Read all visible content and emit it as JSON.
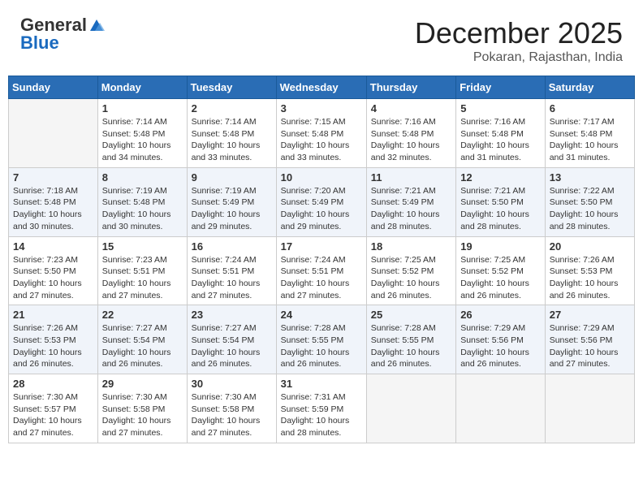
{
  "header": {
    "logo_general": "General",
    "logo_blue": "Blue",
    "title": "December 2025",
    "subtitle": "Pokaran, Rajasthan, India"
  },
  "weekdays": [
    "Sunday",
    "Monday",
    "Tuesday",
    "Wednesday",
    "Thursday",
    "Friday",
    "Saturday"
  ],
  "weeks": [
    [
      {
        "day": "",
        "info": ""
      },
      {
        "day": "1",
        "info": "Sunrise: 7:14 AM\nSunset: 5:48 PM\nDaylight: 10 hours\nand 34 minutes."
      },
      {
        "day": "2",
        "info": "Sunrise: 7:14 AM\nSunset: 5:48 PM\nDaylight: 10 hours\nand 33 minutes."
      },
      {
        "day": "3",
        "info": "Sunrise: 7:15 AM\nSunset: 5:48 PM\nDaylight: 10 hours\nand 33 minutes."
      },
      {
        "day": "4",
        "info": "Sunrise: 7:16 AM\nSunset: 5:48 PM\nDaylight: 10 hours\nand 32 minutes."
      },
      {
        "day": "5",
        "info": "Sunrise: 7:16 AM\nSunset: 5:48 PM\nDaylight: 10 hours\nand 31 minutes."
      },
      {
        "day": "6",
        "info": "Sunrise: 7:17 AM\nSunset: 5:48 PM\nDaylight: 10 hours\nand 31 minutes."
      }
    ],
    [
      {
        "day": "7",
        "info": "Sunrise: 7:18 AM\nSunset: 5:48 PM\nDaylight: 10 hours\nand 30 minutes."
      },
      {
        "day": "8",
        "info": "Sunrise: 7:19 AM\nSunset: 5:48 PM\nDaylight: 10 hours\nand 30 minutes."
      },
      {
        "day": "9",
        "info": "Sunrise: 7:19 AM\nSunset: 5:49 PM\nDaylight: 10 hours\nand 29 minutes."
      },
      {
        "day": "10",
        "info": "Sunrise: 7:20 AM\nSunset: 5:49 PM\nDaylight: 10 hours\nand 29 minutes."
      },
      {
        "day": "11",
        "info": "Sunrise: 7:21 AM\nSunset: 5:49 PM\nDaylight: 10 hours\nand 28 minutes."
      },
      {
        "day": "12",
        "info": "Sunrise: 7:21 AM\nSunset: 5:50 PM\nDaylight: 10 hours\nand 28 minutes."
      },
      {
        "day": "13",
        "info": "Sunrise: 7:22 AM\nSunset: 5:50 PM\nDaylight: 10 hours\nand 28 minutes."
      }
    ],
    [
      {
        "day": "14",
        "info": "Sunrise: 7:23 AM\nSunset: 5:50 PM\nDaylight: 10 hours\nand 27 minutes."
      },
      {
        "day": "15",
        "info": "Sunrise: 7:23 AM\nSunset: 5:51 PM\nDaylight: 10 hours\nand 27 minutes."
      },
      {
        "day": "16",
        "info": "Sunrise: 7:24 AM\nSunset: 5:51 PM\nDaylight: 10 hours\nand 27 minutes."
      },
      {
        "day": "17",
        "info": "Sunrise: 7:24 AM\nSunset: 5:51 PM\nDaylight: 10 hours\nand 27 minutes."
      },
      {
        "day": "18",
        "info": "Sunrise: 7:25 AM\nSunset: 5:52 PM\nDaylight: 10 hours\nand 26 minutes."
      },
      {
        "day": "19",
        "info": "Sunrise: 7:25 AM\nSunset: 5:52 PM\nDaylight: 10 hours\nand 26 minutes."
      },
      {
        "day": "20",
        "info": "Sunrise: 7:26 AM\nSunset: 5:53 PM\nDaylight: 10 hours\nand 26 minutes."
      }
    ],
    [
      {
        "day": "21",
        "info": "Sunrise: 7:26 AM\nSunset: 5:53 PM\nDaylight: 10 hours\nand 26 minutes."
      },
      {
        "day": "22",
        "info": "Sunrise: 7:27 AM\nSunset: 5:54 PM\nDaylight: 10 hours\nand 26 minutes."
      },
      {
        "day": "23",
        "info": "Sunrise: 7:27 AM\nSunset: 5:54 PM\nDaylight: 10 hours\nand 26 minutes."
      },
      {
        "day": "24",
        "info": "Sunrise: 7:28 AM\nSunset: 5:55 PM\nDaylight: 10 hours\nand 26 minutes."
      },
      {
        "day": "25",
        "info": "Sunrise: 7:28 AM\nSunset: 5:55 PM\nDaylight: 10 hours\nand 26 minutes."
      },
      {
        "day": "26",
        "info": "Sunrise: 7:29 AM\nSunset: 5:56 PM\nDaylight: 10 hours\nand 26 minutes."
      },
      {
        "day": "27",
        "info": "Sunrise: 7:29 AM\nSunset: 5:56 PM\nDaylight: 10 hours\nand 27 minutes."
      }
    ],
    [
      {
        "day": "28",
        "info": "Sunrise: 7:30 AM\nSunset: 5:57 PM\nDaylight: 10 hours\nand 27 minutes."
      },
      {
        "day": "29",
        "info": "Sunrise: 7:30 AM\nSunset: 5:58 PM\nDaylight: 10 hours\nand 27 minutes."
      },
      {
        "day": "30",
        "info": "Sunrise: 7:30 AM\nSunset: 5:58 PM\nDaylight: 10 hours\nand 27 minutes."
      },
      {
        "day": "31",
        "info": "Sunrise: 7:31 AM\nSunset: 5:59 PM\nDaylight: 10 hours\nand 28 minutes."
      },
      {
        "day": "",
        "info": ""
      },
      {
        "day": "",
        "info": ""
      },
      {
        "day": "",
        "info": ""
      }
    ]
  ]
}
